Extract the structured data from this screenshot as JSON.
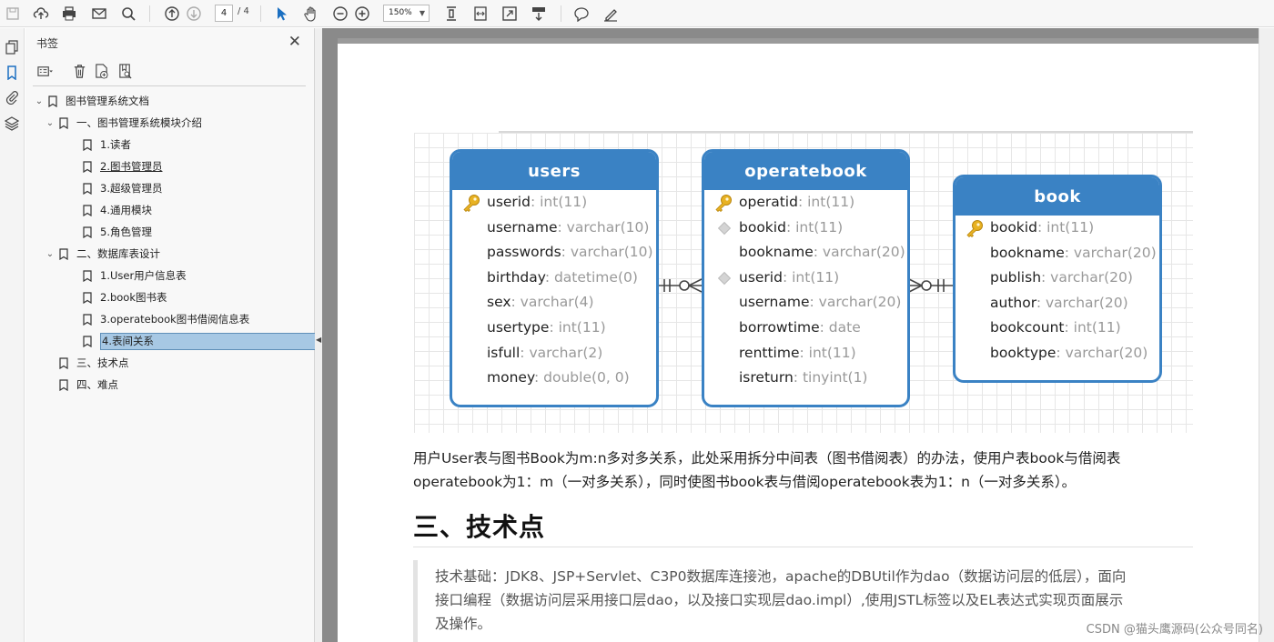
{
  "toolbar": {
    "icons": [
      "save-icon",
      "upload-icon",
      "print-icon",
      "email-icon",
      "search-icon",
      "page-up-icon",
      "page-down-icon",
      "select-cursor-icon",
      "hand-icon",
      "zoom-out-icon",
      "zoom-in-icon",
      "fit-page-icon",
      "fit-width-icon",
      "full-screen-icon",
      "scroll-mode-icon",
      "comment-icon",
      "highlight-icon"
    ],
    "current_page": "4",
    "total_pages": "/ 4",
    "zoom": "150%"
  },
  "bookmarks_panel": {
    "title": "书签",
    "items": [
      {
        "label": "图书管理系统文档",
        "level": 0,
        "expanded": true
      },
      {
        "label": "一、图书管理系统模块介绍",
        "level": 1,
        "expanded": true
      },
      {
        "label": "1.读者",
        "level": 2
      },
      {
        "label": "2.图书管理员",
        "level": 2
      },
      {
        "label": "3.超级管理员",
        "level": 2
      },
      {
        "label": "4.通用模块",
        "level": 2
      },
      {
        "label": "5.角色管理",
        "level": 2
      },
      {
        "label": "二、数据库表设计",
        "level": 1,
        "expanded": true
      },
      {
        "label": "1.User用户信息表",
        "level": 2
      },
      {
        "label": "2.book图书表",
        "level": 2
      },
      {
        "label": "3.operatebook图书借阅信息表",
        "level": 2
      },
      {
        "label": "4.表间关系",
        "level": 2,
        "selected": true
      },
      {
        "label": "三、技术点",
        "level": 1
      },
      {
        "label": "四、难点",
        "level": 1
      }
    ]
  },
  "diagram": {
    "entities": [
      {
        "name": "users",
        "fields": [
          {
            "name": "userid",
            "type": "int(11)",
            "marker": "pk"
          },
          {
            "name": "username",
            "type": "varchar(10)"
          },
          {
            "name": "passwords",
            "type": "varchar(10)"
          },
          {
            "name": "birthday",
            "type": "datetime(0)"
          },
          {
            "name": "sex",
            "type": "varchar(4)"
          },
          {
            "name": "usertype",
            "type": "int(11)"
          },
          {
            "name": "isfull",
            "type": "varchar(2)"
          },
          {
            "name": "money",
            "type": "double(0, 0)"
          }
        ]
      },
      {
        "name": "operatebook",
        "fields": [
          {
            "name": "operatid",
            "type": "int(11)",
            "marker": "pk"
          },
          {
            "name": "bookid",
            "type": "int(11)",
            "marker": "fk"
          },
          {
            "name": "bookname",
            "type": "varchar(20)"
          },
          {
            "name": "userid",
            "type": "int(11)",
            "marker": "fk"
          },
          {
            "name": "username",
            "type": "varchar(20)"
          },
          {
            "name": "borrowtime",
            "type": "date"
          },
          {
            "name": "renttime",
            "type": "int(11)"
          },
          {
            "name": "isreturn",
            "type": "tinyint(1)"
          }
        ]
      },
      {
        "name": "book",
        "fields": [
          {
            "name": "bookid",
            "type": "int(11)",
            "marker": "pk"
          },
          {
            "name": "bookname",
            "type": "varchar(20)"
          },
          {
            "name": "publish",
            "type": "varchar(20)"
          },
          {
            "name": "author",
            "type": "varchar(20)"
          },
          {
            "name": "bookcount",
            "type": "int(11)"
          },
          {
            "name": "booktype",
            "type": "varchar(20)"
          }
        ]
      }
    ]
  },
  "content": {
    "desc_line1": "用户User表与图书Book为m:n多对多关系，此处采用拆分中间表（图书借阅表）的办法，使用户表book与借阅表",
    "desc_line2": "operatebook为1：m（一对多关系），同时使图书book表与借阅operatebook表为1：n（一对多关系）。",
    "heading": "三、技术点",
    "quote_line1": "技术基础：JDK8、JSP+Servlet、C3P0数据库连接池，apache的DBUtil作为dao（数据访问层的低层），面向",
    "quote_line2": "接口编程（数据访问层采用接口层dao，以及接口实现层dao.impl）,使用JSTL标签以及EL表达式实现页面展示",
    "quote_line3": "及操作。"
  },
  "watermark": "CSDN @猫头鹰源码(公众号同名)"
}
